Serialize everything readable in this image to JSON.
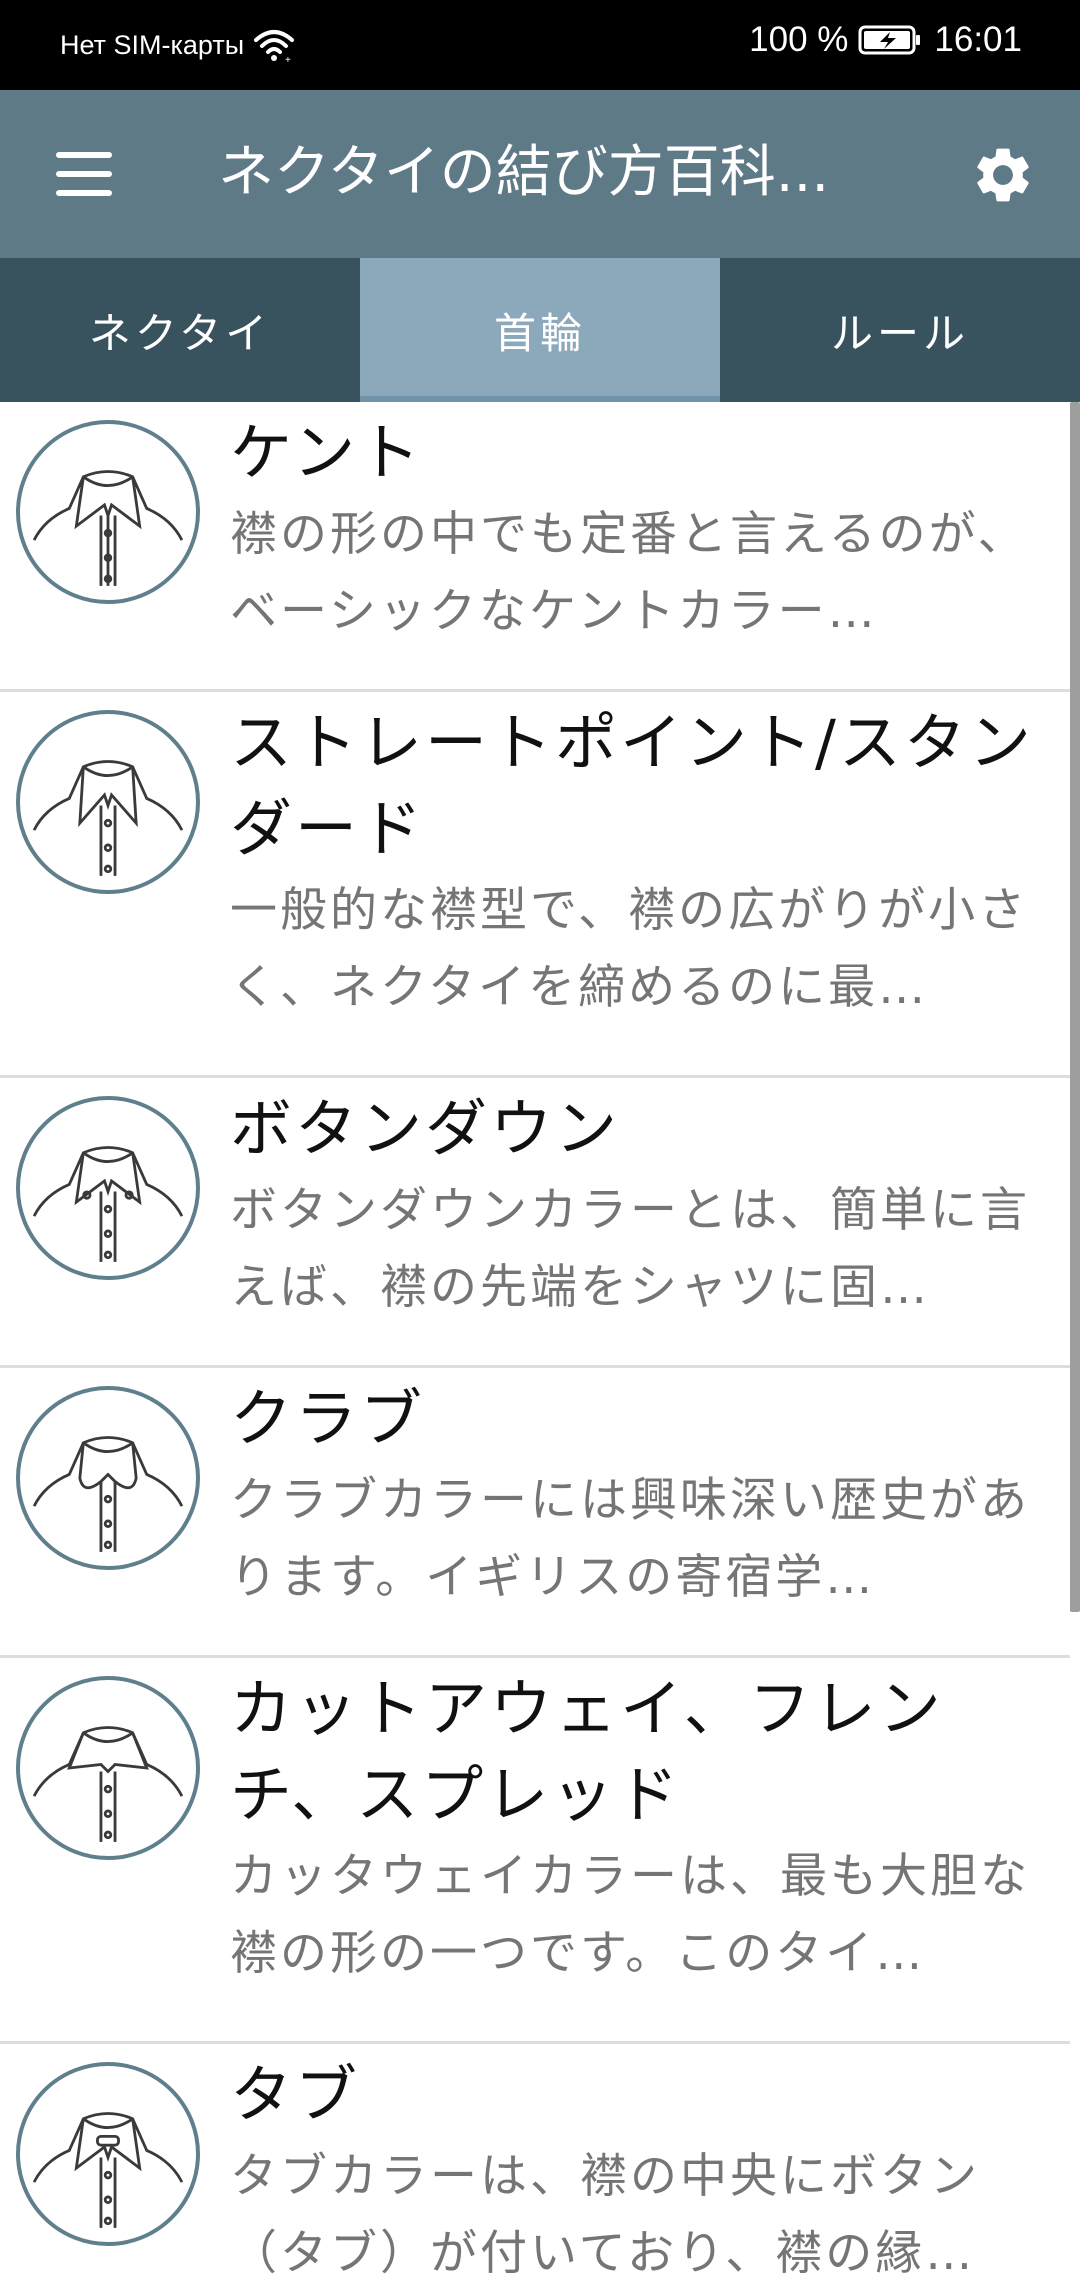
{
  "status_bar": {
    "carrier": "Нет SIM-карты",
    "battery_percent": "100 %",
    "time": "16:01",
    "icons": [
      "wifi-icon",
      "battery-charging-icon"
    ]
  },
  "app_bar": {
    "title": "ネクタイの結び方百科...",
    "menu_icon": "hamburger-menu-icon",
    "settings_icon": "gear-icon",
    "background": "#5f7a87"
  },
  "tabs": [
    {
      "label": "ネクタイ",
      "active": false
    },
    {
      "label": "首輪",
      "active": true
    },
    {
      "label": "ルール",
      "active": false
    }
  ],
  "items": [
    {
      "title": "ケント",
      "description": "襟の形の中でも定番と言えるのが、ベーシックなケントカラー…",
      "icon": "kent-collar-shirt-icon"
    },
    {
      "title": "ストレートポイント/スタンダード",
      "description": "一般的な襟型で、襟の広がりが小さく、ネクタイを締めるのに最…",
      "icon": "straight-point-collar-shirt-icon"
    },
    {
      "title": "ボタンダウン",
      "description": "ボタンダウンカラーとは、簡単に言えば、襟の先端をシャツに固…",
      "icon": "button-down-collar-shirt-icon"
    },
    {
      "title": "クラブ",
      "description": "クラブカラーには興味深い歴史があります。イギリスの寄宿学…",
      "icon": "club-collar-shirt-icon"
    },
    {
      "title": "カットアウェイ、フレンチ、スプレッド",
      "description": "カッタウェイカラーは、最も大胆な襟の形の一つです。このタイ…",
      "icon": "cutaway-collar-shirt-icon"
    },
    {
      "title": "タブ",
      "description": "タブカラーは、襟の中央にボタン（タブ）が付いており、襟の縁…",
      "icon": "tab-collar-shirt-icon"
    }
  ],
  "colors": {
    "status_bar": "#000000",
    "app_bar": "#5f7a87",
    "tab_bar": "#38525e",
    "tab_active": "#8ca9bb",
    "icon_ring": "#5f7f8d"
  }
}
